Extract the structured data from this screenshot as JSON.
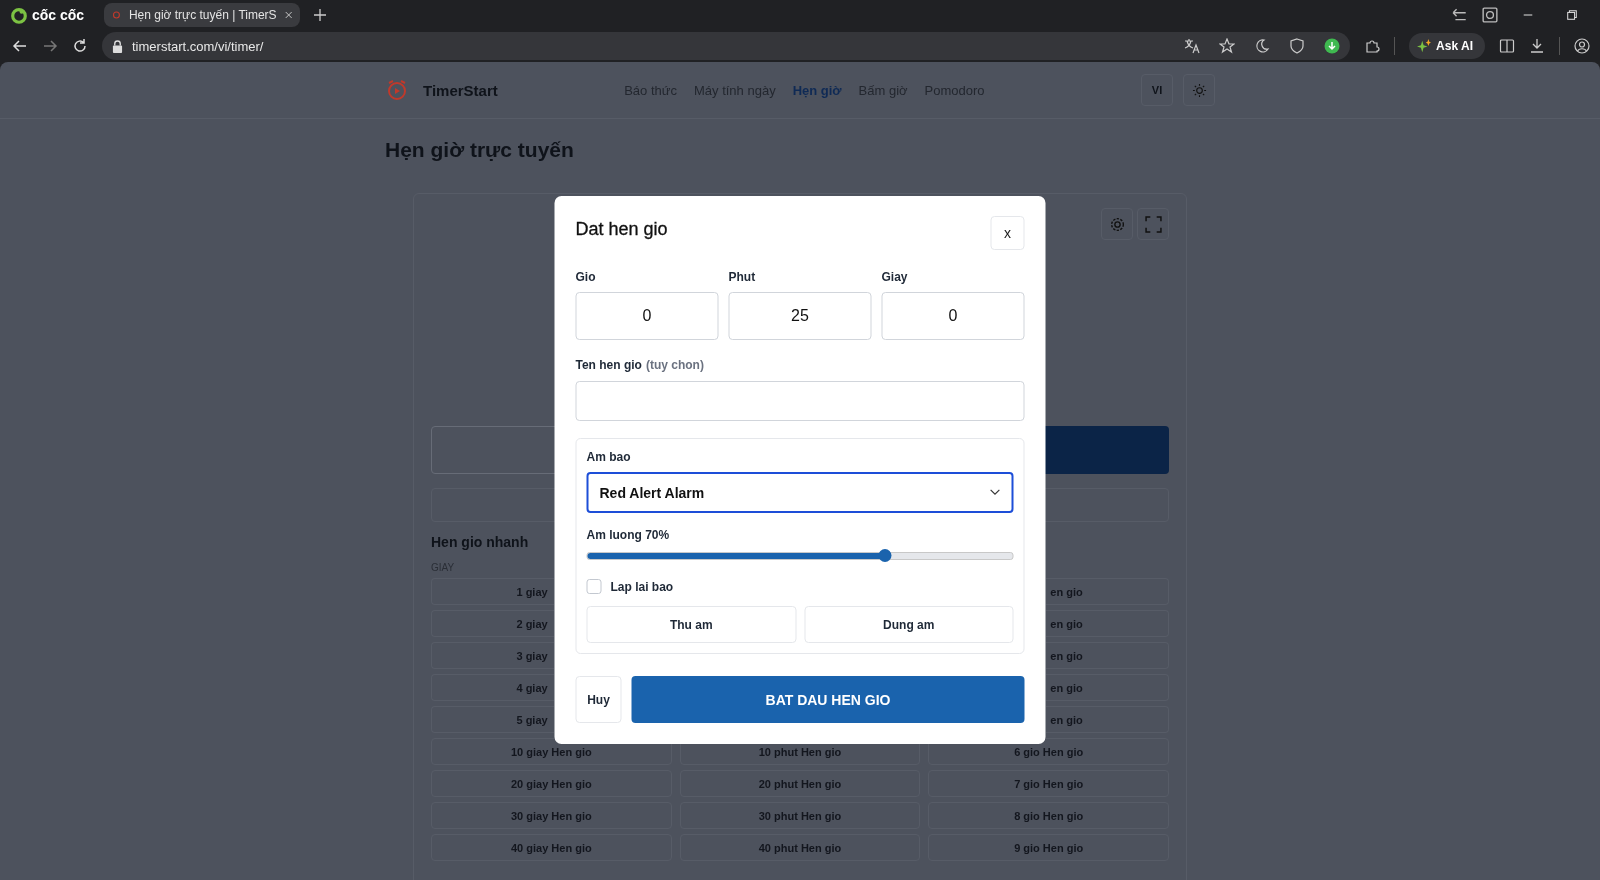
{
  "browser": {
    "brand": "cốc cốc",
    "tab_title": "Hẹn giờ trực tuyến | TimerS",
    "url": "timerstart.com/vi/timer/",
    "ask_ai": "Ask AI"
  },
  "header": {
    "site_name": "TimerStart",
    "nav": [
      {
        "label": "Báo thức",
        "selected": false
      },
      {
        "label": "Máy tính ngày",
        "selected": false
      },
      {
        "label": "Hẹn giờ",
        "selected": true
      },
      {
        "label": "Bấm giờ",
        "selected": false
      },
      {
        "label": "Pomodoro",
        "selected": false
      }
    ],
    "language": "VI"
  },
  "page_title": "Hẹn giờ trực tuyến",
  "quick_timers": {
    "title": "Hen gio nhanh",
    "group_label": "GIAY",
    "rows": [
      {
        "partial": true,
        "col_1": "1 giay",
        "col_3": "en gio"
      },
      {
        "partial": true,
        "col_1": "2 giay",
        "col_3": "en gio"
      },
      {
        "partial": true,
        "col_1": "3 giay",
        "col_3": "en gio"
      },
      {
        "partial": true,
        "col_1": "4 giay",
        "col_3": "en gio"
      },
      {
        "partial": true,
        "col_1": "5 giay",
        "col_3": "en gio"
      },
      {
        "partial": false,
        "col_1": "10 giay Hen gio",
        "col_2": "10 phut Hen gio",
        "col_3": "6 gio Hen gio"
      },
      {
        "partial": false,
        "col_1": "20 giay Hen gio",
        "col_2": "20 phut Hen gio",
        "col_3": "7 gio Hen gio"
      },
      {
        "partial": false,
        "col_1": "30 giay Hen gio",
        "col_2": "30 phut Hen gio",
        "col_3": "8 gio Hen gio"
      },
      {
        "partial": false,
        "col_1": "40 giay Hen gio",
        "col_2": "40 phut Hen gio",
        "col_3": "9 gio Hen gio"
      }
    ]
  },
  "dialog": {
    "title": "Dat hen gio",
    "close": "x",
    "fields": [
      {
        "label": "Gio",
        "value": "0"
      },
      {
        "label": "Phut",
        "value": "25"
      },
      {
        "label": "Giay",
        "value": "0"
      }
    ],
    "name_label": "Ten hen gio",
    "name_hint": "(tuy chon)",
    "sound_label": "Am bao",
    "sound": "Red Alert Alarm",
    "volume_label": "Am luong 70%",
    "volume": {
      "level": 0.7
    },
    "repeat": {
      "label": "Lap lai bao",
      "checked": false
    },
    "sound_buttons": [
      "Thu am",
      "Dung am"
    ],
    "cancel": "Huy",
    "start": "BAT DAU HEN GIO"
  }
}
